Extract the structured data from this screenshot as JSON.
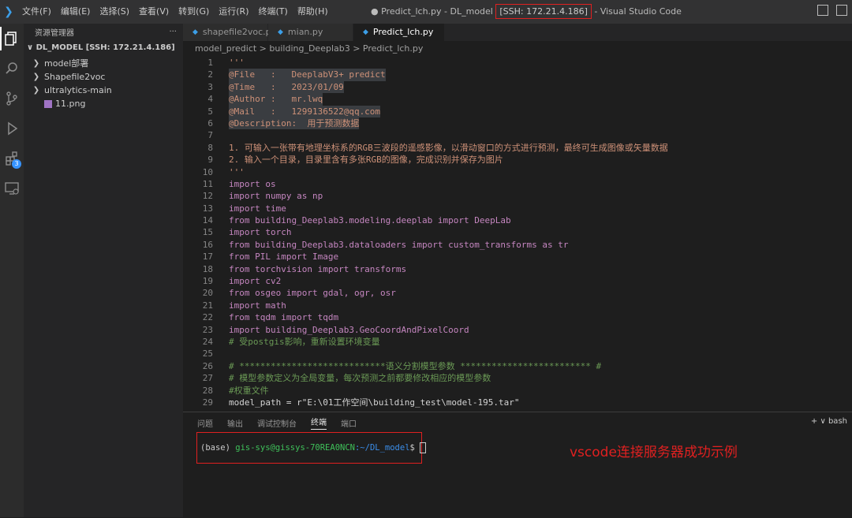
{
  "titlebar": {
    "menus": [
      "文件(F)",
      "编辑(E)",
      "选择(S)",
      "查看(V)",
      "转到(G)",
      "运行(R)",
      "终端(T)",
      "帮助(H)"
    ],
    "title_prefix": "● Predict_lch.py - DL_model",
    "title_ssh": "[SSH: 172.21.4.186]",
    "title_suffix": "- Visual Studio Code"
  },
  "activity_bar": {
    "items": [
      "explorer-icon",
      "search-icon",
      "source-control-icon",
      "run-debug-icon",
      "extensions-icon",
      "remote-explorer-icon"
    ],
    "extensions_badge": "3"
  },
  "sidebar": {
    "header": "资源管理器",
    "more": "···",
    "section": "DL_MODEL [SSH: 172.21.4.186]",
    "items": [
      {
        "label": "model部署",
        "type": "folder"
      },
      {
        "label": "Shapefile2voc",
        "type": "folder"
      },
      {
        "label": "ultralytics-main",
        "type": "folder"
      },
      {
        "label": "11.png",
        "type": "file"
      }
    ]
  },
  "tabs": [
    {
      "label": "shapefile2voc.py",
      "active": false
    },
    {
      "label": "mian.py",
      "active": false
    },
    {
      "label": "Predict_lch.py",
      "active": true
    }
  ],
  "breadcrumb": "model_predict > building_Deeplab3 > Predict_lch.py",
  "code_lines": [
    {
      "n": "1",
      "t": "'''"
    },
    {
      "n": "2",
      "t": "@File   :   DeeplabV3+ predict"
    },
    {
      "n": "3",
      "t": "@Time   :   2023/01/09"
    },
    {
      "n": "4",
      "t": "@Author :   mr.lwq"
    },
    {
      "n": "5",
      "t": "@Mail   :   1299136522@qq.com"
    },
    {
      "n": "6",
      "t": "@Description:  用于预测数据"
    },
    {
      "n": "7",
      "t": ""
    },
    {
      "n": "8",
      "t": "1. 可输入一张带有地理坐标系的RGB三波段的遥感影像，以滑动窗口的方式进行预测，最终可生成图像或矢量数据"
    },
    {
      "n": "9",
      "t": "2. 输入一个目录，目录里含有多张RGB的图像，完成识别并保存为图片"
    },
    {
      "n": "10",
      "t": "'''"
    },
    {
      "n": "11",
      "t": "import os"
    },
    {
      "n": "12",
      "t": "import numpy as np"
    },
    {
      "n": "13",
      "t": "import time"
    },
    {
      "n": "14",
      "t": "from building_Deeplab3.modeling.deeplab import DeepLab"
    },
    {
      "n": "15",
      "t": "import torch"
    },
    {
      "n": "16",
      "t": "from building_Deeplab3.dataloaders import custom_transforms as tr"
    },
    {
      "n": "17",
      "t": "from PIL import Image"
    },
    {
      "n": "18",
      "t": "from torchvision import transforms"
    },
    {
      "n": "19",
      "t": "import cv2"
    },
    {
      "n": "20",
      "t": "from osgeo import gdal, ogr, osr"
    },
    {
      "n": "21",
      "t": "import math"
    },
    {
      "n": "22",
      "t": "from tqdm import tqdm"
    },
    {
      "n": "23",
      "t": "import building_Deeplab3.GeoCoordAndPixelCoord"
    },
    {
      "n": "24",
      "t": "# 受postgis影响，重新设置环境变量"
    },
    {
      "n": "25",
      "t": ""
    },
    {
      "n": "26",
      "t": "# ****************************语义分割模型参数 ************************* #"
    },
    {
      "n": "27",
      "t": "# 模型参数定义为全局变量，每次预测之前都要修改相应的模型参数"
    },
    {
      "n": "28",
      "t": "#权重文件"
    },
    {
      "n": "29",
      "t": "model_path = r\"E:\\01工作空间\\building_test\\model-195.tar\""
    }
  ],
  "panel": {
    "tabs": [
      "问题",
      "输出",
      "调试控制台",
      "终端",
      "端口"
    ],
    "active_tab": "终端",
    "right": "+ ∨  bash",
    "terminal_prefix": "(base) ",
    "terminal_user": "gis-sys@gissys-70REA0NCN",
    "terminal_path": ":~/DL_model",
    "terminal_prompt": "$ ",
    "caption": "vscode连接服务器成功示例"
  }
}
